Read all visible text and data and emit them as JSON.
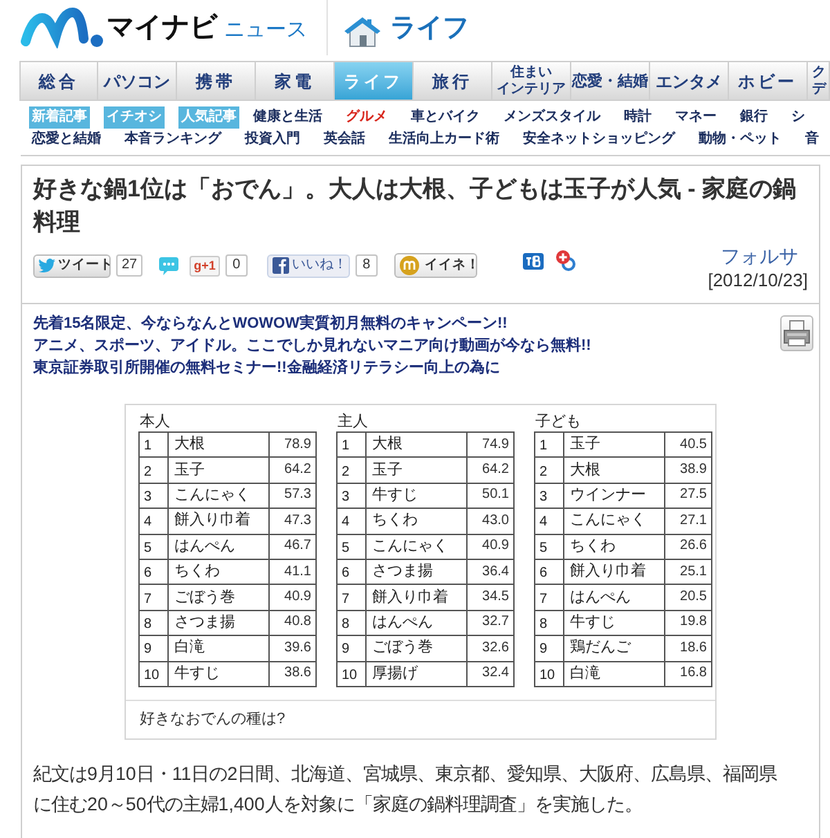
{
  "header": {
    "brand": "マイナビ",
    "brand_suffix": "ニュース",
    "section": "ライフ"
  },
  "nav_tabs": [
    {
      "lines": [
        "総合"
      ],
      "selected": false
    },
    {
      "lines": [
        "パソコン"
      ],
      "selected": false
    },
    {
      "lines": [
        "携帯"
      ],
      "selected": false
    },
    {
      "lines": [
        "家電"
      ],
      "selected": false
    },
    {
      "lines": [
        "ライフ"
      ],
      "selected": true
    },
    {
      "lines": [
        "旅行"
      ],
      "selected": false
    },
    {
      "lines": [
        "住まい",
        "インテリア"
      ],
      "selected": false
    },
    {
      "lines": [
        "恋愛・結婚"
      ],
      "selected": false
    },
    {
      "lines": [
        "エンタメ"
      ],
      "selected": false
    },
    {
      "lines": [
        "ホビー"
      ],
      "selected": false
    },
    {
      "lines": [
        "ク",
        "デ"
      ],
      "selected": false
    }
  ],
  "sub_nav": [
    [
      {
        "label": "新着記事",
        "kind": "tag"
      },
      {
        "label": "イチオシ",
        "kind": "tag"
      },
      {
        "label": "人気記事",
        "kind": "tag"
      },
      {
        "label": "健康と生活",
        "kind": "link"
      },
      {
        "label": "グルメ",
        "kind": "hot"
      },
      {
        "label": "車とバイク",
        "kind": "link"
      },
      {
        "label": "メンズスタイル",
        "kind": "link"
      },
      {
        "label": "時計",
        "kind": "link"
      },
      {
        "label": "マネー",
        "kind": "link"
      },
      {
        "label": "銀行",
        "kind": "link"
      },
      {
        "label": "シ",
        "kind": "link"
      }
    ],
    [
      {
        "label": "恋愛と結婚",
        "kind": "link"
      },
      {
        "label": "本音ランキング",
        "kind": "link"
      },
      {
        "label": "投資入門",
        "kind": "link"
      },
      {
        "label": "英会話",
        "kind": "link"
      },
      {
        "label": "生活向上カード術",
        "kind": "link"
      },
      {
        "label": "安全ネットショッピング",
        "kind": "link"
      },
      {
        "label": "動物・ペット",
        "kind": "link"
      },
      {
        "label": "音",
        "kind": "link"
      }
    ]
  ],
  "article": {
    "title": "好きな鍋1位は「おでん」。大人は大根、子どもは玉子が人気 - 家庭の鍋料理",
    "share": [
      {
        "kind": "tweet",
        "label": "ツイート",
        "count": "27"
      },
      {
        "kind": "comment"
      },
      {
        "kind": "plusone",
        "label": "g+1",
        "count": "0"
      },
      {
        "kind": "like",
        "label": "いいね！",
        "count": "8"
      },
      {
        "kind": "mixi",
        "label": "イイネ！"
      },
      {
        "kind": "bookmark"
      },
      {
        "kind": "clip"
      }
    ],
    "author": "フォルサ",
    "date": "[2012/10/23]"
  },
  "ads": [
    "先着15名限定、今ならなんとWOWOW実質初月無料のキャンペーン!!",
    "アニメ、スポーツ、アイドル。ここでしか見れないマニア向け動画が今なら無料!!",
    "東京証券取引所開催の無料セミナー!!金融経済リテラシー向上の為に"
  ],
  "figure": {
    "tables": [
      {
        "heading": "本人",
        "rows": [
          {
            "rank": "1",
            "item": "大根",
            "value": "78.9"
          },
          {
            "rank": "2",
            "item": "玉子",
            "value": "64.2"
          },
          {
            "rank": "3",
            "item": "こんにゃく",
            "value": "57.3"
          },
          {
            "rank": "4",
            "item": "餅入り巾着",
            "value": "47.3"
          },
          {
            "rank": "5",
            "item": "はんぺん",
            "value": "46.7"
          },
          {
            "rank": "6",
            "item": "ちくわ",
            "value": "41.1"
          },
          {
            "rank": "7",
            "item": "ごぼう巻",
            "value": "40.9"
          },
          {
            "rank": "8",
            "item": "さつま揚",
            "value": "40.8"
          },
          {
            "rank": "9",
            "item": "白滝",
            "value": "39.6"
          },
          {
            "rank": "10",
            "item": "牛すじ",
            "value": "38.6"
          }
        ]
      },
      {
        "heading": "主人",
        "rows": [
          {
            "rank": "1",
            "item": "大根",
            "value": "74.9"
          },
          {
            "rank": "2",
            "item": "玉子",
            "value": "64.2"
          },
          {
            "rank": "3",
            "item": "牛すじ",
            "value": "50.1"
          },
          {
            "rank": "4",
            "item": "ちくわ",
            "value": "43.0"
          },
          {
            "rank": "5",
            "item": "こんにゃく",
            "value": "40.9"
          },
          {
            "rank": "6",
            "item": "さつま揚",
            "value": "36.4"
          },
          {
            "rank": "7",
            "item": "餅入り巾着",
            "value": "34.5"
          },
          {
            "rank": "8",
            "item": "はんぺん",
            "value": "32.7"
          },
          {
            "rank": "9",
            "item": "ごぼう巻",
            "value": "32.6"
          },
          {
            "rank": "10",
            "item": "厚揚げ",
            "value": "32.4"
          }
        ]
      },
      {
        "heading": "子ども",
        "rows": [
          {
            "rank": "1",
            "item": "玉子",
            "value": "40.5"
          },
          {
            "rank": "2",
            "item": "大根",
            "value": "38.9"
          },
          {
            "rank": "3",
            "item": "ウインナー",
            "value": "27.5"
          },
          {
            "rank": "4",
            "item": "こんにゃく",
            "value": "27.1"
          },
          {
            "rank": "5",
            "item": "ちくわ",
            "value": "26.6"
          },
          {
            "rank": "6",
            "item": "餅入り巾着",
            "value": "25.1"
          },
          {
            "rank": "7",
            "item": "はんぺん",
            "value": "20.5"
          },
          {
            "rank": "8",
            "item": "牛すじ",
            "value": "19.8"
          },
          {
            "rank": "9",
            "item": "鶏だんご",
            "value": "18.6"
          },
          {
            "rank": "10",
            "item": "白滝",
            "value": "16.8"
          }
        ]
      }
    ],
    "caption": "好きなおでんの種は?"
  },
  "body": "紀文は9月10日・11日の2日間、北海道、宮城県、東京都、愛知県、大阪府、広島県、福岡県に住む20～50代の主婦1,400人を対象に「家庭の鍋料理調査」を実施した。"
}
